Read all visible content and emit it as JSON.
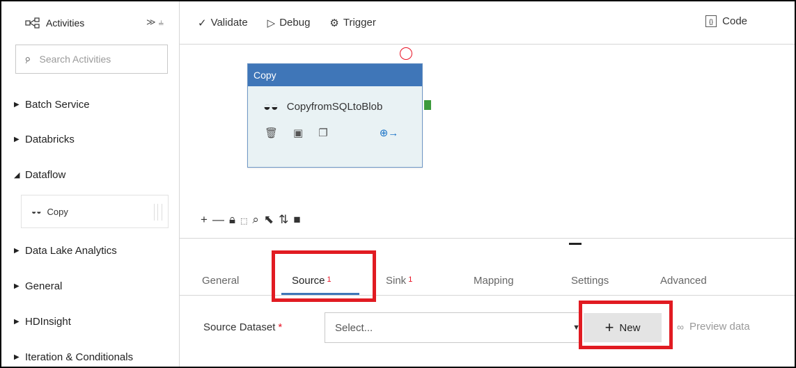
{
  "sidebar": {
    "title": "Activities",
    "search_placeholder": "Search Activities",
    "categories": [
      {
        "label": "Batch Service"
      },
      {
        "label": "Databricks"
      },
      {
        "label": "Dataflow"
      },
      {
        "label": "Data Lake Analytics"
      },
      {
        "label": "General"
      },
      {
        "label": "HDInsight"
      },
      {
        "label": "Iteration & Conditionals"
      }
    ],
    "dataflow_item": "Copy"
  },
  "toolbar": {
    "validate": "Validate",
    "debug": "Debug",
    "trigger": "Trigger",
    "code": "Code"
  },
  "canvas": {
    "activity_type": "Copy",
    "activity_name": "CopyfromSQLtoBlob"
  },
  "properties": {
    "tabs": [
      {
        "label": "General"
      },
      {
        "label": "Source",
        "badge": "1"
      },
      {
        "label": "Sink",
        "badge": "1"
      },
      {
        "label": "Mapping"
      },
      {
        "label": "Settings"
      },
      {
        "label": "Advanced"
      }
    ],
    "active_tab": "Source",
    "source_dataset_label": "Source Dataset",
    "required_marker": "*",
    "select_placeholder": "Select...",
    "new_label": "New",
    "preview_label": "Preview data"
  },
  "colors": {
    "accent": "#3f76b8",
    "highlight": "#e11b22",
    "connector": "#3d9b3d"
  },
  "icons": [
    "pipeline-icon",
    "collapse-icon",
    "pin-icon",
    "search-icon",
    "check-icon",
    "debug-icon",
    "trigger-icon",
    "code-icon",
    "copy-activity-icon",
    "delete-icon",
    "code-small-icon",
    "clone-icon",
    "add-output-icon",
    "preview-icon"
  ]
}
